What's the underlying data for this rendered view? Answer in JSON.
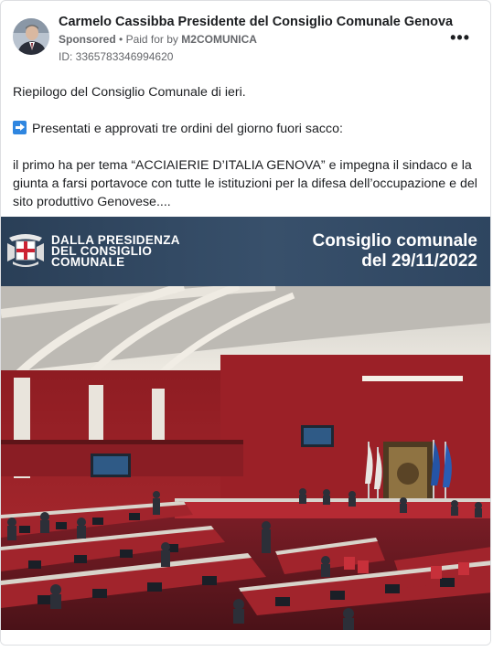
{
  "post": {
    "page_name": "Carmelo Cassibba Presidente del Consiglio Comunale Genova",
    "sponsored_label": "Sponsored",
    "paid_for_prefix": "Paid for by",
    "payer": "M2COMUNICA",
    "ad_id": "ID: 3365783346994620",
    "more_label": "•••"
  },
  "text": {
    "p1": "Riepilogo del Consiglio Comunale di ieri.",
    "p2": "Presentati e approvati tre ordini del giorno fuori sacco:",
    "p3": "il primo ha per tema “ACCIAIERIE D’ITALIA GENOVA” e impegna il sindaco e la giunta a farsi portavoce con tutte le istituzioni per la difesa dell’occupazione e del sito produttivo Genovese...."
  },
  "image": {
    "banner_left_line1": "DALLA PRESIDENZA",
    "banner_left_line2": "DEL CONSIGLIO",
    "banner_left_line3": "COMUNALE",
    "banner_right_line1": "Consiglio comunale",
    "banner_right_line2": "del 29/11/2022"
  },
  "icons": {
    "arrow": "right-arrow-emoji-icon",
    "crest": "genova-crest-icon",
    "more": "more-options-icon"
  }
}
